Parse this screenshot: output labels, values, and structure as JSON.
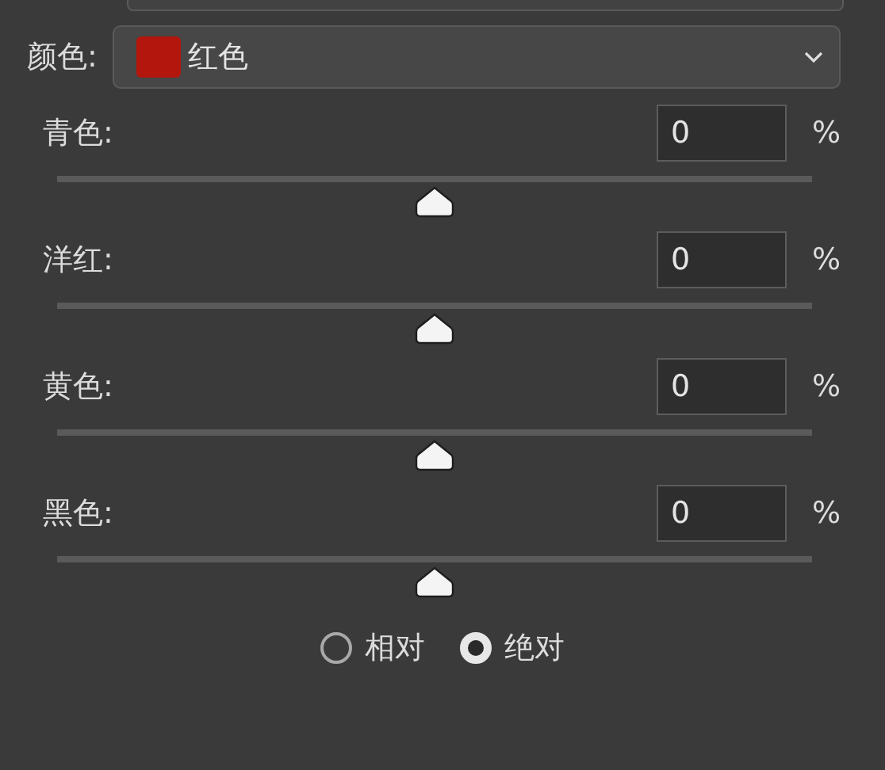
{
  "color": {
    "label": "颜色:",
    "value": "红色",
    "kind": "red"
  },
  "sliders": [
    {
      "label": "青色:",
      "value": "0",
      "unit": "%",
      "level": 0.5
    },
    {
      "label": "洋红:",
      "value": "0",
      "unit": "%",
      "level": 0.5
    },
    {
      "label": "黄色:",
      "value": "0",
      "unit": "%",
      "level": 0.5
    },
    {
      "label": "黑色:",
      "value": "0",
      "unit": "%",
      "level": 0.5
    }
  ],
  "method": [
    {
      "label": "相对",
      "selected": false
    },
    {
      "label": "绝对",
      "selected": true
    }
  ]
}
